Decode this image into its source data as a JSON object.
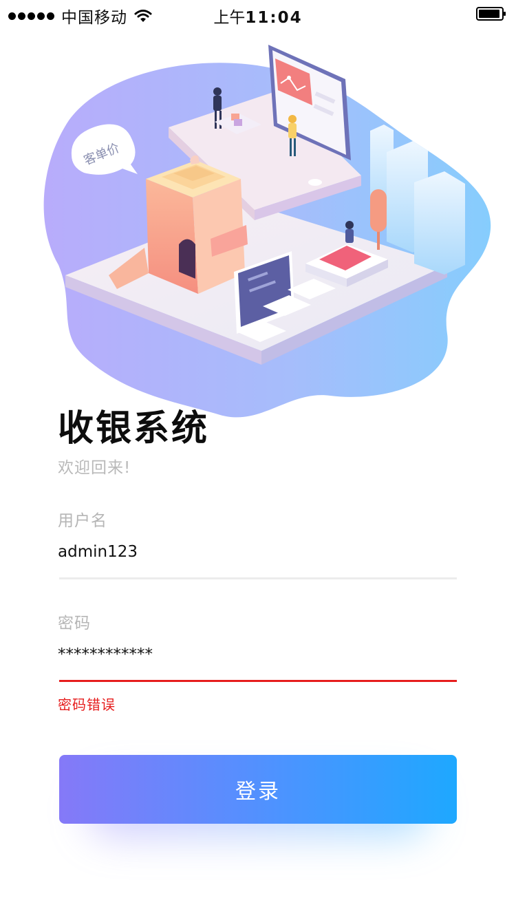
{
  "status_bar": {
    "carrier": "中国移动",
    "time_prefix": "上午",
    "time": "11:04"
  },
  "illustration": {
    "bubble_label": "客单价"
  },
  "header": {
    "title": "收银系统",
    "subtitle": "欢迎回来!"
  },
  "form": {
    "username": {
      "label": "用户名",
      "value": "admin123"
    },
    "password": {
      "label": "密码",
      "value": "************"
    },
    "error_message": "密码错误",
    "login_label": "登录"
  },
  "colors": {
    "accent_start": "#8579f8",
    "accent_end": "#1ea8ff",
    "error": "#e61d1d"
  }
}
